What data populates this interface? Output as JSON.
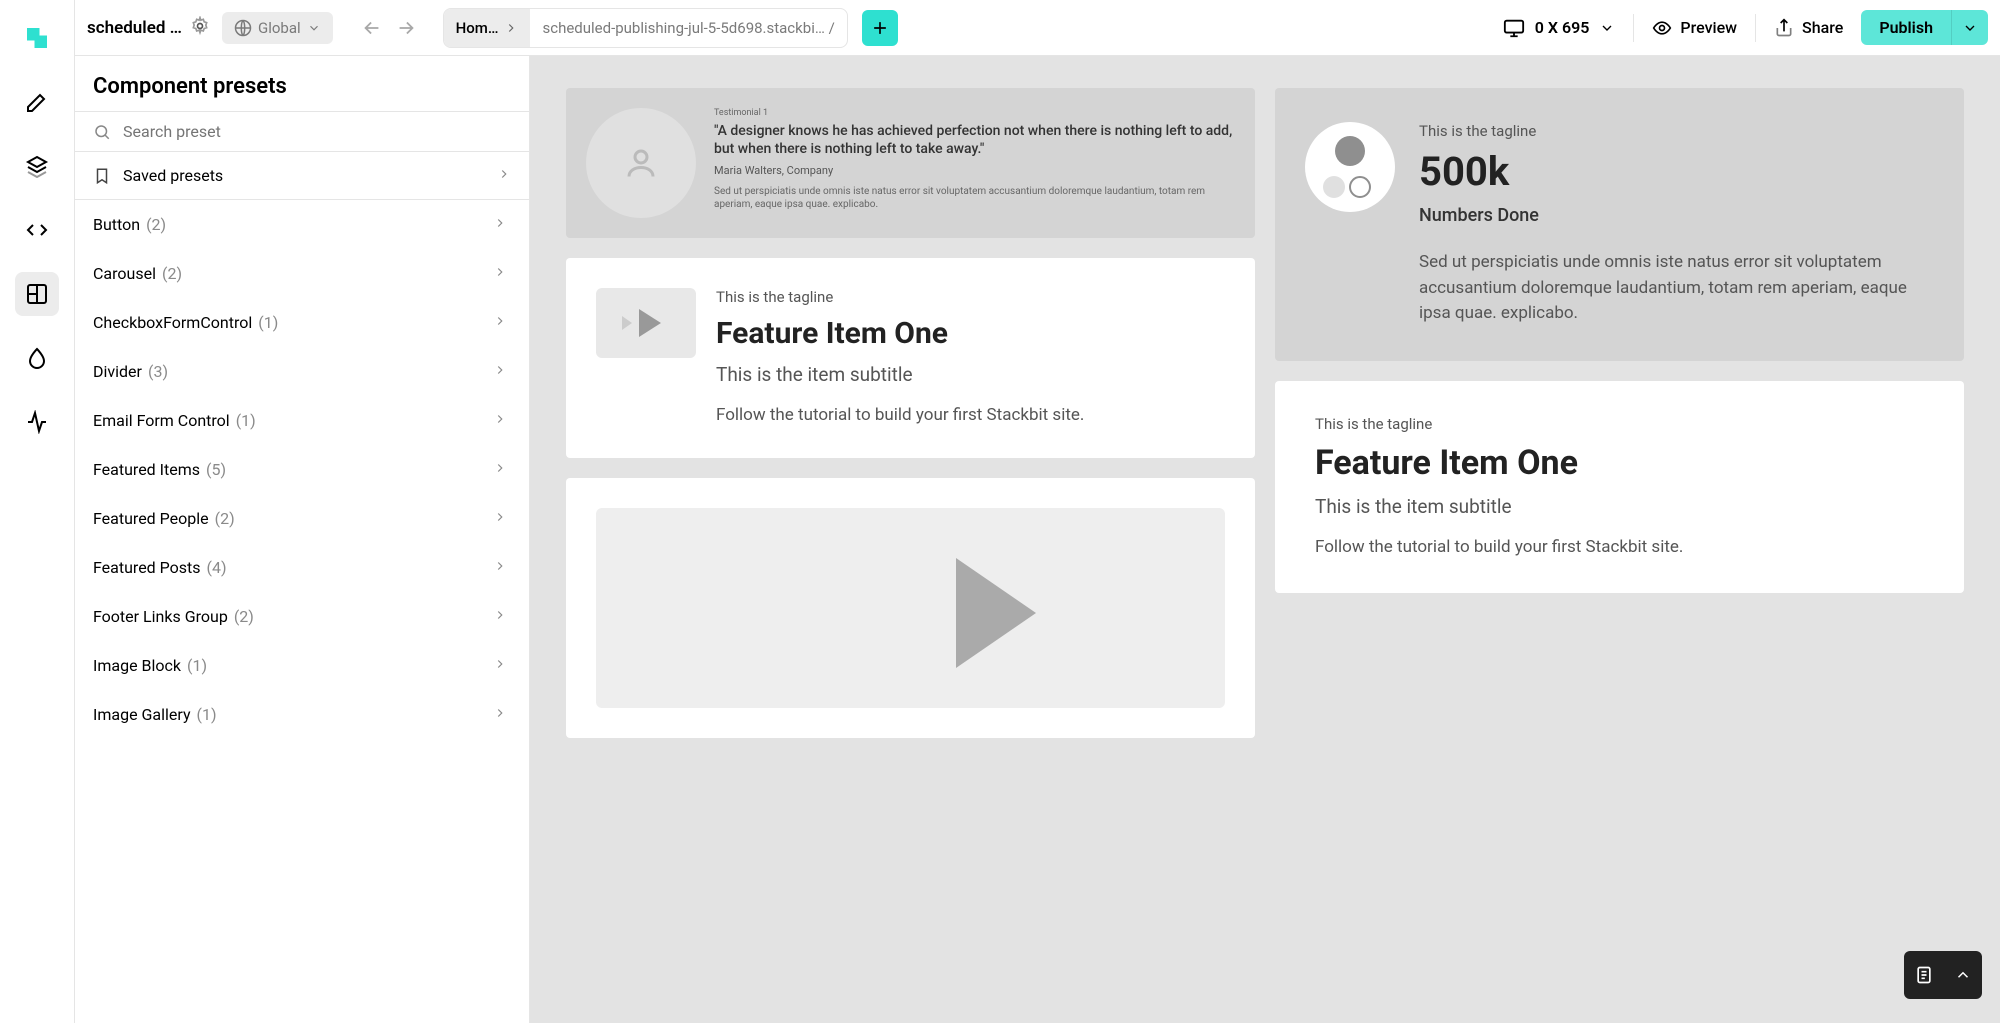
{
  "topbar": {
    "siteName": "scheduled …",
    "global": "Global",
    "crumb": "Hom…",
    "url": "scheduled-publishing-jul-5-5d698.stackbi… /",
    "viewport": "0 X 695",
    "preview": "Preview",
    "share": "Share",
    "publish": "Publish"
  },
  "panel": {
    "title": "Component presets",
    "searchPlaceholder": "Search preset",
    "savedLabel": "Saved presets",
    "presets": [
      {
        "name": "Button",
        "count": "(2)"
      },
      {
        "name": "Carousel",
        "count": "(2)"
      },
      {
        "name": "CheckboxFormControl",
        "count": "(1)"
      },
      {
        "name": "Divider",
        "count": "(3)"
      },
      {
        "name": "Email Form Control",
        "count": "(1)"
      },
      {
        "name": "Featured Items",
        "count": "(5)"
      },
      {
        "name": "Featured People",
        "count": "(2)"
      },
      {
        "name": "Featured Posts",
        "count": "(4)"
      },
      {
        "name": "Footer Links Group",
        "count": "(2)"
      },
      {
        "name": "Image Block",
        "count": "(1)"
      },
      {
        "name": "Image Gallery",
        "count": "(1)"
      }
    ]
  },
  "canvas": {
    "testimonial": {
      "label": "Testimonial 1",
      "quote": "\"A designer knows he has achieved perfection not when there is nothing left to add, but when there is nothing left to take away.\"",
      "name": "Maria Walters, Company",
      "lorem": "Sed ut perspiciatis unde omnis iste natus error sit voluptatem accusantium doloremque laudantium, totam rem aperiam, eaque ipsa quae. explicabo."
    },
    "featureA": {
      "tagline": "This is the tagline",
      "title": "Feature Item One",
      "sub": "This is the item subtitle",
      "desc": "Follow the tutorial to build your first Stackbit site."
    },
    "stat": {
      "tagline": "This is the tagline",
      "value": "500k",
      "label": "Numbers Done",
      "lorem": "Sed ut perspiciatis unde omnis iste natus error sit voluptatem accusantium doloremque laudantium, totam rem aperiam, eaque ipsa quae. explicabo."
    },
    "featureB": {
      "tagline": "This is the tagline",
      "title": "Feature Item One",
      "sub": "This is the item subtitle",
      "desc": "Follow the tutorial to build your first Stackbit site."
    }
  }
}
